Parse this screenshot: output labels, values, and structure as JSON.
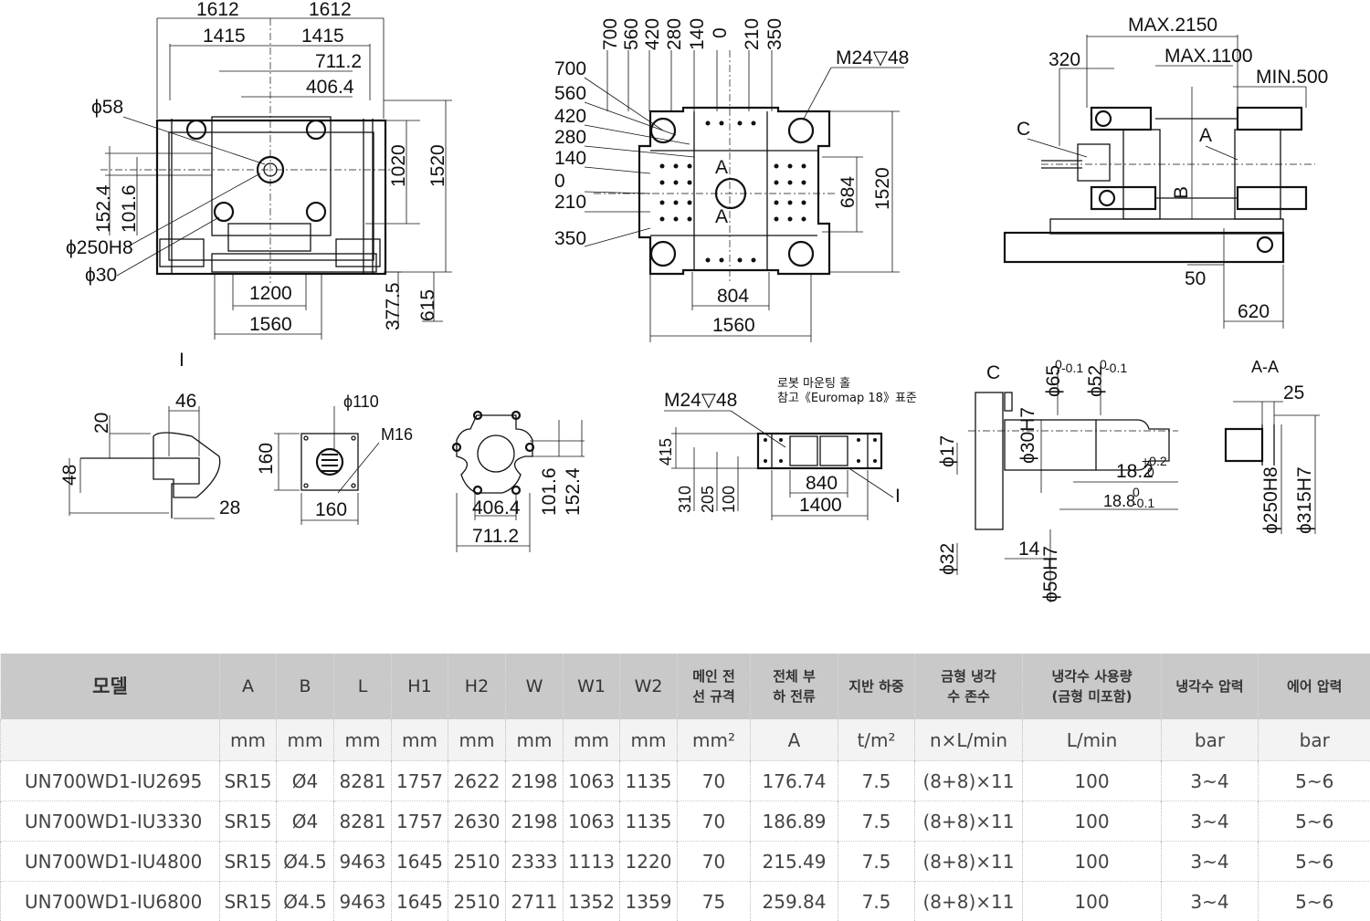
{
  "drawing": {
    "top_left_dims": [
      "1612",
      "1612",
      "1415",
      "1415",
      "711.2",
      "406.4",
      "ϕ58",
      "1020",
      "1520",
      "152.4",
      "101.6",
      "ϕ250H8",
      "ϕ30",
      "1200",
      "1560",
      "377.5",
      "615",
      "I"
    ],
    "top_mid_dims": [
      "700",
      "560",
      "420",
      "280",
      "140",
      "0",
      "210",
      "350",
      "M24▽48",
      "700",
      "560",
      "420",
      "280",
      "140",
      "0",
      "210",
      "350",
      "A",
      "A",
      "684",
      "1520",
      "804",
      "1560"
    ],
    "top_right_dims": [
      "MAX.2150",
      "320",
      "MAX.1100",
      "MIN.500",
      "C",
      "A",
      "B",
      "50",
      "620"
    ],
    "detail_I": [
      "46",
      "20",
      "48",
      "28"
    ],
    "detail_plate": [
      "ϕ110",
      "M16",
      "160",
      "160"
    ],
    "detail_cross": [
      "406.4",
      "711.2",
      "101.6",
      "152.4"
    ],
    "detail_robot": {
      "note_line1": "로봇 마운팅 홀",
      "note_line2": "참고《Euromap 18》표준",
      "dims": [
        "M24▽48",
        "415",
        "310",
        "205",
        "100",
        "840",
        "1400",
        "I"
      ]
    },
    "detail_C": [
      "C",
      "ϕ65",
      "0",
      "-0.1",
      "ϕ52",
      "0",
      "-0.1",
      "ϕ17",
      "ϕ30H7",
      "18.2",
      "+0.2",
      "0",
      "18.8",
      "0",
      "-0.1",
      "ϕ32",
      "14",
      "ϕ50H7"
    ],
    "detail_AA": [
      "A-A",
      "25",
      "ϕ250H8",
      "ϕ315H7"
    ]
  },
  "table": {
    "headers": [
      {
        "lines": [
          "모델"
        ],
        "cls": "big"
      },
      {
        "lines": [
          "A"
        ],
        "cls": "mid"
      },
      {
        "lines": [
          "B"
        ],
        "cls": "mid"
      },
      {
        "lines": [
          "L"
        ],
        "cls": "mid"
      },
      {
        "lines": [
          "H1"
        ],
        "cls": "mid"
      },
      {
        "lines": [
          "H2"
        ],
        "cls": "mid"
      },
      {
        "lines": [
          "W"
        ],
        "cls": "mid"
      },
      {
        "lines": [
          "W1"
        ],
        "cls": "mid"
      },
      {
        "lines": [
          "W2"
        ],
        "cls": "mid"
      },
      {
        "lines": [
          "메인 전",
          "선 규격"
        ],
        "cls": ""
      },
      {
        "lines": [
          "전체 부",
          "하 전류"
        ],
        "cls": ""
      },
      {
        "lines": [
          "지반 하중"
        ],
        "cls": ""
      },
      {
        "lines": [
          "금형 냉각",
          "수 존수"
        ],
        "cls": ""
      },
      {
        "lines": [
          "냉각수 사용량",
          "(금형 미포함)"
        ],
        "cls": ""
      },
      {
        "lines": [
          "냉각수 압력"
        ],
        "cls": ""
      },
      {
        "lines": [
          "에어 압력"
        ],
        "cls": ""
      }
    ],
    "units": [
      "",
      "mm",
      "mm",
      "mm",
      "mm",
      "mm",
      "mm",
      "mm",
      "mm",
      "mm²",
      "A",
      "t/m²",
      "n×L/min",
      "L/min",
      "bar",
      "bar"
    ],
    "rows": [
      [
        "UN700WD1-IU2695",
        "SR15",
        "Ø4",
        "8281",
        "1757",
        "2622",
        "2198",
        "1063",
        "1135",
        "70",
        "176.74",
        "7.5",
        "(8+8)×11",
        "100",
        "3~4",
        "5~6"
      ],
      [
        "UN700WD1-IU3330",
        "SR15",
        "Ø4",
        "8281",
        "1757",
        "2630",
        "2198",
        "1063",
        "1135",
        "70",
        "186.89",
        "7.5",
        "(8+8)×11",
        "100",
        "3~4",
        "5~6"
      ],
      [
        "UN700WD1-IU4800",
        "SR15",
        "Ø4.5",
        "9463",
        "1645",
        "2510",
        "2333",
        "1113",
        "1220",
        "70",
        "215.49",
        "7.5",
        "(8+8)×11",
        "100",
        "3~4",
        "5~6"
      ],
      [
        "UN700WD1-IU6800",
        "SR15",
        "Ø4.5",
        "9463",
        "1645",
        "2510",
        "2711",
        "1352",
        "1359",
        "75",
        "259.84",
        "7.5",
        "(8+8)×11",
        "100",
        "3~4",
        "5~6"
      ]
    ]
  }
}
